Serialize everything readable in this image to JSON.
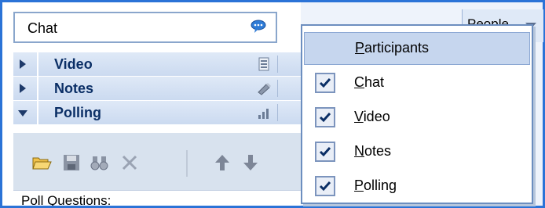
{
  "panel": {
    "chat_label": "Chat",
    "poll_questions_label": "Poll Questions:",
    "sections": [
      {
        "label": "Video",
        "icon": "video-list-icon",
        "expanded": false
      },
      {
        "label": "Notes",
        "icon": "notes-pen-icon",
        "expanded": false
      },
      {
        "label": "Polling",
        "icon": "poll-bars-icon",
        "expanded": true
      }
    ],
    "toolbar": [
      "open-folder-icon",
      "save-disk-icon",
      "binoculars-icon",
      "delete-x-icon",
      "arrow-up-icon",
      "arrow-down-icon"
    ]
  },
  "right_header": {
    "text": "People"
  },
  "menu": {
    "items": [
      {
        "label_first": "P",
        "label_rest": "articipants",
        "checked": false,
        "highlighted": true
      },
      {
        "label_first": "C",
        "label_rest": "hat",
        "checked": true,
        "highlighted": false
      },
      {
        "label_first": "V",
        "label_rest": "ideo",
        "checked": true,
        "highlighted": false
      },
      {
        "label_first": "N",
        "label_rest": "otes",
        "checked": true,
        "highlighted": false
      },
      {
        "label_first": "P",
        "label_rest": "olling",
        "checked": true,
        "highlighted": false
      }
    ]
  },
  "colors": {
    "frame_border": "#2b73d7",
    "section_title": "#0b2f66",
    "menu_highlight": "#c6d6ee"
  }
}
